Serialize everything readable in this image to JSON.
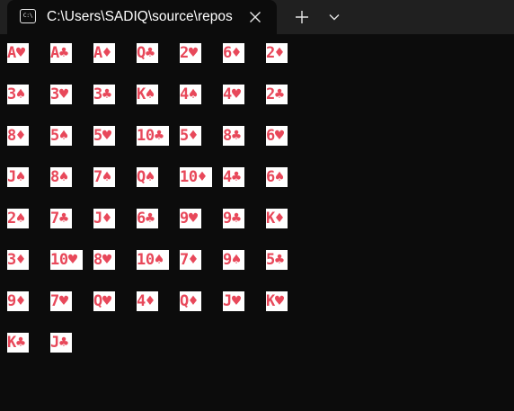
{
  "tab": {
    "title": "C:\\Users\\SADIQ\\source\\repos",
    "icon_name": "terminal-icon",
    "icon_glyph": "C:\\",
    "close_icon_name": "close-icon"
  },
  "toolbar": {
    "new_tab_icon_name": "plus-icon",
    "dropdown_icon_name": "chevron-down-icon"
  },
  "colors": {
    "background": "#0c0c0c",
    "tabbar": "#202020",
    "card_bg": "#ffffff",
    "card_text": "#e8485a"
  },
  "cards": [
    [
      "A♥",
      "A♣",
      "A♦",
      "Q♣",
      "2♥",
      "6♦",
      "2♦"
    ],
    [
      "3♠",
      "3♥",
      "3♣",
      "K♠",
      "4♠",
      "4♥",
      "2♣"
    ],
    [
      "8♦",
      "5♠",
      "5♥",
      "10♣",
      "5♦",
      "8♣",
      "6♥"
    ],
    [
      "J♠",
      "8♠",
      "7♠",
      "Q♠",
      "10♦",
      "4♣",
      "6♠"
    ],
    [
      "2♠",
      "7♣",
      "J♦",
      "6♣",
      "9♥",
      "9♣",
      "K♦"
    ],
    [
      "3♦",
      "10♥",
      "8♥",
      "10♠",
      "7♦",
      "9♠",
      "5♣"
    ],
    [
      "9♦",
      "7♥",
      "Q♥",
      "4♦",
      "Q♦",
      "J♥",
      "K♥"
    ],
    [
      "K♣",
      "J♣"
    ]
  ]
}
